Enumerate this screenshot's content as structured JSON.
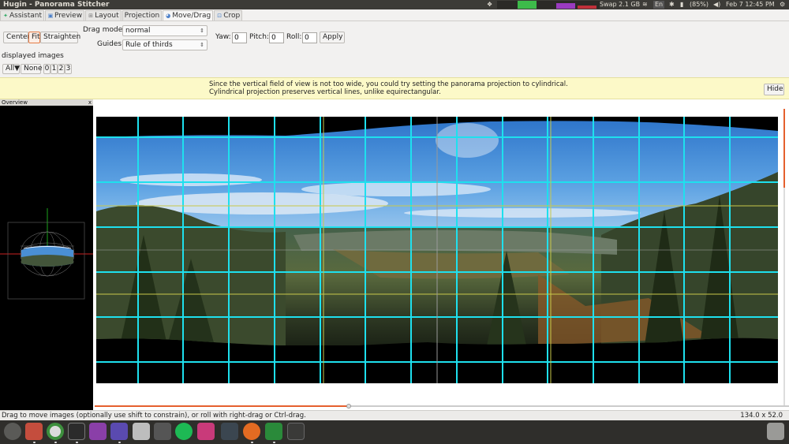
{
  "top_panel": {
    "app_title": "Hugin - Panorama Stitcher",
    "swap": "Swap 2.1 GB",
    "battery": "(85%)",
    "keyboard": "En",
    "clock": "Feb  7 12:45 PM"
  },
  "tabs": [
    {
      "label": "Assistant",
      "icon": "assistant-icon"
    },
    {
      "label": "Preview",
      "icon": "preview-icon"
    },
    {
      "label": "Layout",
      "icon": "layout-icon"
    },
    {
      "label": "Projection",
      "icon": ""
    },
    {
      "label": "Move/Drag",
      "icon": "move-icon"
    },
    {
      "label": "Crop",
      "icon": "crop-icon"
    }
  ],
  "active_tab": "Move/Drag",
  "toolbar": {
    "center_label": "Center",
    "fit_label": "Fit",
    "straighten_label": "Straighten",
    "drag_mode_label": "Drag mode:",
    "drag_mode_value": "normal",
    "guides_label": "Guides:",
    "guides_value": "Rule of thirds",
    "yaw_label": "Yaw:",
    "yaw_value": "0",
    "pitch_label": "Pitch:",
    "pitch_value": "0",
    "roll_label": "Roll:",
    "roll_value": "0",
    "apply_label": "Apply"
  },
  "displayed_images": {
    "label": "displayed images",
    "all_label": "All▼",
    "none_label": "None",
    "image_buttons": [
      "0",
      "1",
      "2",
      "3"
    ]
  },
  "hint": {
    "line1": "Since the vertical field of view is not too wide, you could try setting the panorama projection to cylindrical.",
    "line2": "Cylindrical projection preserves vertical lines, unlike equirectangular.",
    "hide_label": "Hide"
  },
  "overview": {
    "title": "Overview",
    "close_glyph": "x"
  },
  "statusbar": {
    "left": "Drag to move images (optionally use shift to constrain), or roll with right-drag or Ctrl-drag.",
    "right": "134.0 x 52.0"
  },
  "colors": {
    "grid_line": "#1ee0ee",
    "thirds_line": "#c8c84a",
    "accent": "#e5602e",
    "hint_bg": "#fcf9c8"
  },
  "dock_icons": [
    "ubuntu-dash-icon",
    "files-icon",
    "chrome-icon",
    "terminal-icon",
    "media-icon",
    "gitk-icon",
    "drive-icon",
    "calculator-icon",
    "spotify-icon",
    "app-icon",
    "system-monitor-icon",
    "firefox-icon",
    "hugin-icon",
    "window-icon",
    "trash-icon"
  ]
}
